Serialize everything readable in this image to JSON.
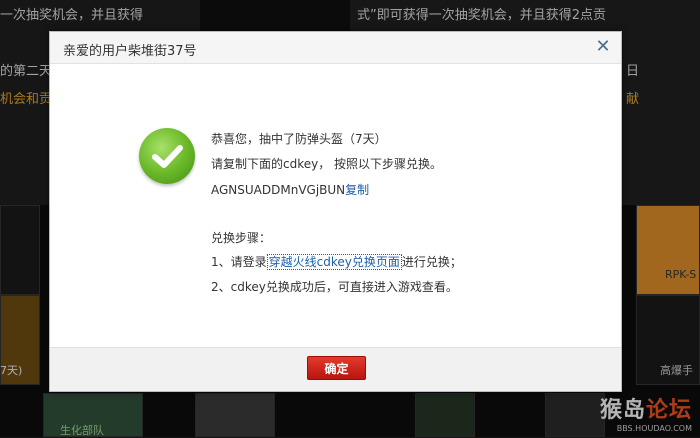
{
  "background": {
    "promo_top_left": "一次抽奖机会，并且获得",
    "promo_top_right": "式”即可获得一次抽奖机会，并且获得2点贡",
    "promo_mid_left_1": "的第二天",
    "promo_mid_left_2": "机会和贡",
    "promo_mid_right_1": "日",
    "promo_mid_right_2": "献",
    "item_label_right": "RPK-S",
    "item_label_bottom_left": "7天)",
    "item_label_bottom_right": "高爆手",
    "item_label_bottom_cell": "生化部队"
  },
  "watermark": {
    "main_a": "猴岛",
    "main_b": "论坛",
    "sub": "BBS.HOUDAO.COM"
  },
  "dialog": {
    "title": "亲爱的用户柴堆街37号",
    "close_glyph": "✕",
    "line1": "恭喜您，抽中了防弹头盔（7天）",
    "line2": "请复制下面的cdkey， 按照以下步骤兑换。",
    "cdkey": "AGNSUADDMnVGjBUN",
    "copy_label": "复制",
    "steps_title": "兑换步骤：",
    "step1_prefix": "1、请登录",
    "step1_link": "穿越火线cdkey兑换页面",
    "step1_suffix": "进行兑换；",
    "step2": "2、cdkey兑换成功后，可直接进入游戏查看。",
    "ok_label": "确定"
  }
}
